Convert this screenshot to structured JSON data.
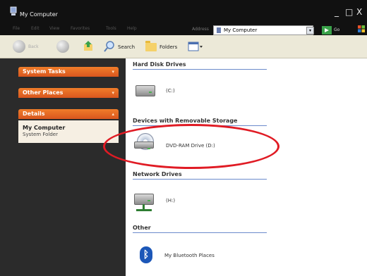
{
  "window": {
    "title": "My Computer",
    "controls": [
      "_",
      "□",
      "X"
    ]
  },
  "menubar": {
    "items": [
      "File",
      "Edit",
      "View",
      "Favorites",
      "Tools",
      "Help"
    ]
  },
  "address": {
    "label": "Address",
    "value": "My Computer",
    "go_label": "Go"
  },
  "toolbar": {
    "back_label": "Back",
    "search_label": "Search",
    "folders_label": "Folders",
    "views_icon": "views-icon"
  },
  "left_pane": {
    "system_tasks": "System Tasks",
    "other_places": "Other Places",
    "details": "Details",
    "details_title": "My Computer",
    "details_sub": "System Folder"
  },
  "content": {
    "groups": [
      {
        "title": "Hard Disk Drives",
        "items": [
          {
            "label": "(C:)",
            "icon": "hard-drive-icon"
          }
        ]
      },
      {
        "title": "Devices with Removable Storage",
        "items": [
          {
            "label": "DVD-RAM Drive (D:)",
            "icon": "dvd-drive-icon"
          }
        ]
      },
      {
        "title": "Network Drives",
        "items": [
          {
            "label": "(H:)",
            "icon": "network-drive-icon"
          }
        ]
      },
      {
        "title": "Other",
        "items": [
          {
            "label": "My Bluetooth Places",
            "icon": "bluetooth-icon"
          }
        ]
      }
    ]
  },
  "colors": {
    "task_header": "#e8672a",
    "highlight_circle": "#e01b24",
    "accent_rule": "#6b8acb"
  }
}
